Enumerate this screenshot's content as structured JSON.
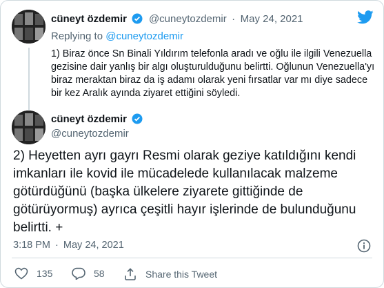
{
  "reply": {
    "author_name": "cüneyt özdemir",
    "author_handle": "@cuneytozdemir",
    "dot": "·",
    "date": "May 24, 2021",
    "replying_label": "Replying to",
    "replying_handle": "@cuneytozdemir",
    "text": "1) Biraz önce Sn Binali Yıldırım telefonla aradı ve oğlu ile ilgili Venezuella gezisine dair yanlış bir algı oluşturulduğunu belirtti. Oğlunun Venezuella'yı biraz meraktan biraz da iş adamı olarak yeni fırsatlar var mı diye sadece bir kez Aralık ayında ziyaret ettiğini söyledi."
  },
  "main": {
    "author_name": "cüneyt özdemir",
    "author_handle": "@cuneytozdemir",
    "text": "2) Heyetten ayrı gayrı Resmi olarak geziye katıldığını kendi imkanları ile kovid ile mücadelede kullanılacak malzeme götürdüğünü (başka ülkelere ziyarete gittiğinde de götürüyormuş)  ayrıca çeşitli hayır işlerinde de bulunduğunu belirtti. +",
    "time": "3:18 PM",
    "dot": "·",
    "date": "May 24, 2021"
  },
  "actions": {
    "likes": "135",
    "replies": "58",
    "share_label": "Share this Tweet"
  },
  "colors": {
    "twitter_blue": "#1d9bf0",
    "text_primary": "#0f1419",
    "text_secondary": "#536471",
    "border": "#cfd9de"
  },
  "icons": [
    "twitter-logo-icon",
    "verified-badge-icon",
    "info-icon",
    "heart-icon",
    "reply-icon",
    "share-icon"
  ]
}
